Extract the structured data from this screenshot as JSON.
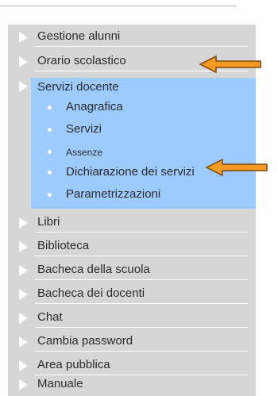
{
  "menu": {
    "items_top": [
      {
        "label": "Gestione alunni"
      },
      {
        "label": "Orario scolastico"
      }
    ],
    "servizi_docente": {
      "label": "Servizi docente",
      "subitems": [
        {
          "label": "Anagrafica"
        },
        {
          "label": "Servizi"
        },
        {
          "label": "Assenze"
        },
        {
          "label": "Dichiarazione dei servizi"
        },
        {
          "label": "Parametrizzazioni"
        }
      ]
    },
    "items_bottom": [
      {
        "label": "Libri"
      },
      {
        "label": "Biblioteca"
      },
      {
        "label": "Bacheca della scuola"
      },
      {
        "label": "Bacheca dei docenti"
      },
      {
        "label": "Chat"
      },
      {
        "label": "Cambia password"
      },
      {
        "label": "Area pubblica"
      },
      {
        "label": "Manuale"
      }
    ]
  },
  "colors": {
    "panel": "#d6d6d6",
    "highlight": "#9ecbff",
    "arrow": "#f59a23"
  },
  "icons": {
    "item_marker": "triangle-right-icon",
    "sub_marker": "bullet-dot-icon",
    "annotation": "arrow-left-icon"
  }
}
